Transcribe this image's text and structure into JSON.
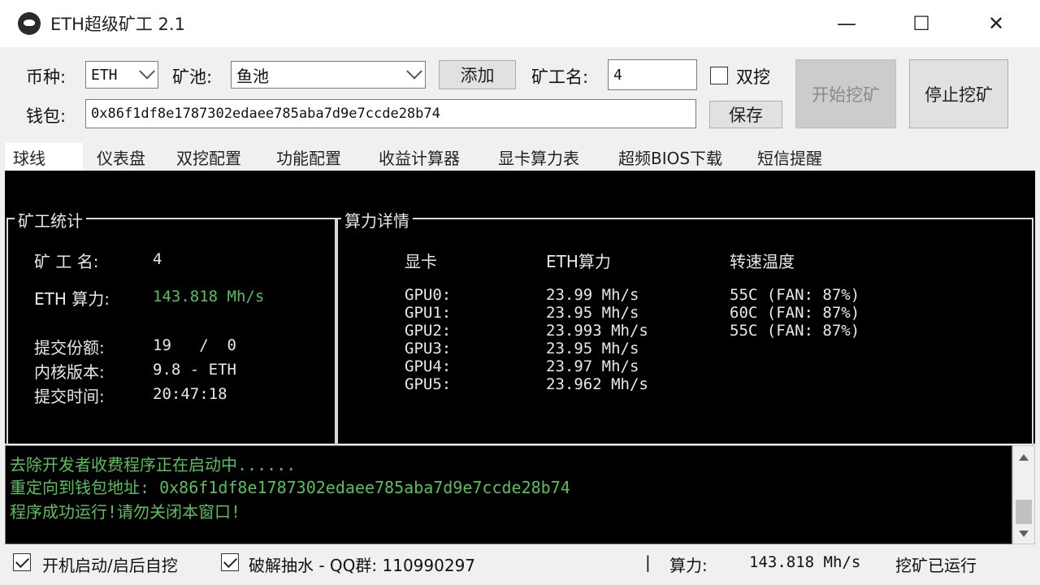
{
  "window": {
    "title": "ETH超级矿工 2.1",
    "minimize_glyph": "—",
    "maximize_glyph": "☐",
    "close_glyph": "✕"
  },
  "toolbar": {
    "coin_label": "币种:",
    "coin_value": "ETH",
    "pool_label": "矿池:",
    "pool_value": "鱼池",
    "add_button": "添加",
    "miner_name_label": "矿工名:",
    "miner_name_value": "4",
    "dual_mining_label": "双挖",
    "dual_mining_checked": false,
    "start_button": "开始挖矿",
    "stop_button": "停止挖矿",
    "wallet_label": "钱包:",
    "wallet_value": "0x86f1df8e1787302edaee785aba7d9e7ccde28b74",
    "save_button": "保存"
  },
  "tabs": [
    {
      "label": "球线",
      "active": true
    },
    {
      "label": "仪表盘",
      "active": false
    },
    {
      "label": "双挖配置",
      "active": false
    },
    {
      "label": "功能配置",
      "active": false
    },
    {
      "label": "收益计算器",
      "active": false
    },
    {
      "label": "显卡算力表",
      "active": false
    },
    {
      "label": "超频BIOS下载",
      "active": false
    },
    {
      "label": "短信提醒",
      "active": false
    }
  ],
  "miner_stats": {
    "group_title": "矿工统计",
    "name_label": "矿 工 名:",
    "name_value": "4",
    "hashrate_label": "ETH 算力:",
    "hashrate_value": "143.818 Mh/s",
    "shares_label": "提交份额:",
    "shares_value": "19   /  0",
    "core_label": "内核版本:",
    "core_value": "9.8 - ETH",
    "time_label": "提交时间:",
    "time_value": "20:47:18"
  },
  "hash_details": {
    "group_title": "算力详情",
    "col_gpu": "显卡",
    "col_hash": "ETH算力",
    "col_temp": "转速温度",
    "gpus": [
      {
        "name": "GPU0:",
        "hash": "23.99 Mh/s",
        "temp": "55C (FAN: 87%)"
      },
      {
        "name": "GPU1:",
        "hash": "23.95 Mh/s",
        "temp": "60C (FAN: 87%)"
      },
      {
        "name": "GPU2:",
        "hash": "23.993 Mh/s",
        "temp": "55C (FAN: 87%)"
      },
      {
        "name": "GPU3:",
        "hash": "23.95 Mh/s",
        "temp": ""
      },
      {
        "name": "GPU4:",
        "hash": "23.97 Mh/s",
        "temp": ""
      },
      {
        "name": "GPU5:",
        "hash": "23.962 Mh/s",
        "temp": ""
      }
    ]
  },
  "log": [
    "去除开发者收费程序正在启动中......",
    "重定向到钱包地址: 0x86f1df8e1787302edaee785aba7d9e7ccde28b74",
    "程序成功运行!请勿关闭本窗口!"
  ],
  "status": {
    "autostart_label": "开机启动/启后自挖",
    "autostart_checked": true,
    "crack_label": "破解抽水 - QQ群: 110990297",
    "crack_checked": true,
    "separator": "|",
    "hashrate_label": "算力:",
    "hashrate_value": "143.818 Mh/s",
    "state": "挖矿已运行"
  },
  "colors": {
    "console_bg": "#000000",
    "console_text": "#e8e8e8",
    "accent_green": "#58c05a"
  }
}
